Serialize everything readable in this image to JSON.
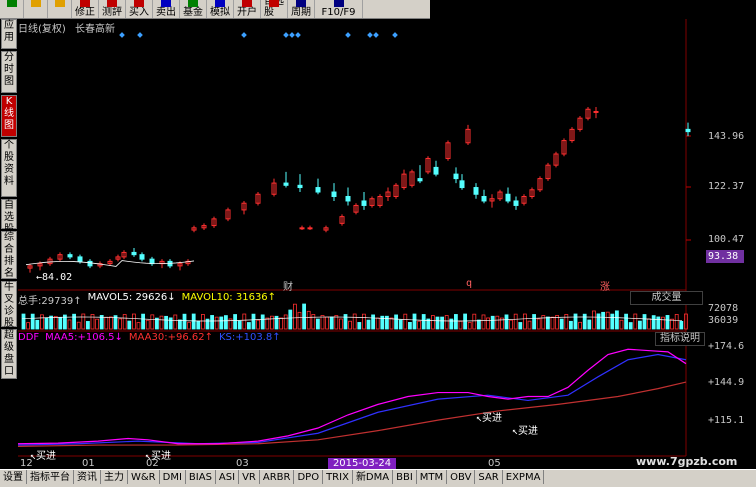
{
  "toolbar": {
    "buttons": [
      {
        "label": "",
        "icon": "grid-icon"
      },
      {
        "label": "",
        "icon": "arrow-up-icon"
      },
      {
        "label": "",
        "icon": "arrow-down-icon"
      },
      {
        "label": "修正",
        "icon": "edit-icon"
      },
      {
        "label": "测評",
        "icon": "rate-icon"
      },
      {
        "label": "买入",
        "icon": "buy-icon"
      },
      {
        "label": "卖出",
        "icon": "sell-icon"
      },
      {
        "label": "基金",
        "icon": "fund-icon"
      },
      {
        "label": "模拟",
        "icon": "sim-icon"
      },
      {
        "label": "开户",
        "icon": "account-icon"
      },
      {
        "label": "自选股",
        "icon": "star-icon"
      },
      {
        "label": "周期",
        "icon": "period-icon"
      },
      {
        "label": "F10/F9",
        "icon": "f10-icon"
      }
    ]
  },
  "sidebar": {
    "tabs": [
      {
        "label": "应用"
      },
      {
        "label": "分时图"
      },
      {
        "label": "K线图",
        "active": true
      },
      {
        "label": "个股资料"
      },
      {
        "label": "自选股"
      },
      {
        "label": "综合排名"
      },
      {
        "label": "牛叉诊股"
      },
      {
        "label": "超级盘口"
      }
    ]
  },
  "header": {
    "title": "日线(复权)",
    "stock_name": "长春高新"
  },
  "price_axis": {
    "labels": [
      "143.96",
      "122.37",
      "100.47"
    ],
    "current_price": "93.38",
    "low_marker": "84.02"
  },
  "event_marks": [
    "财",
    "q",
    "涨"
  ],
  "volume": {
    "total_label": "总手:",
    "total_value": "29739",
    "mavol5_label": "MAVOL5:",
    "mavol5_value": "29626",
    "mavol10_label": "MAVOL10:",
    "mavol10_value": "31636",
    "selector": "成交量",
    "axis": [
      "72078",
      "36039"
    ]
  },
  "indicator": {
    "name": "DDF",
    "maa5_label": "MAA5:",
    "maa5_value": "+106.5",
    "maa30_label": "MAA30:",
    "maa30_value": "+96.62",
    "ks_label": "KS:",
    "ks_value": "+103.8",
    "help": "指标说明",
    "axis": [
      "+174.6",
      "+144.9",
      "+115.1"
    ],
    "buy_signal": "买进"
  },
  "time_axis": {
    "months": [
      "12",
      "01",
      "02",
      "03",
      "05"
    ],
    "selected_date": "2015-03-24"
  },
  "bottom_tabs": [
    "设置",
    "指标平台",
    "资讯",
    "主力",
    "W&R",
    "DMI",
    "BIAS",
    "ASI",
    "VR",
    "ARBR",
    "DPO",
    "TRIX",
    "新DMA",
    "BBI",
    "MTM",
    "OBV",
    "SAR",
    "EXPMA"
  ],
  "watermark": "www.7gpzb.com",
  "colors": {
    "up": "#ff3030",
    "down": "#54ffff",
    "ma_magenta": "#ff00ff",
    "ma_blue": "#3030ff",
    "ma_red": "#c03030",
    "accent": "#7030a0"
  },
  "chart_data": {
    "type": "candlestick",
    "price_ylim": [
      84.02,
      160
    ],
    "ohlc_sample": [
      [
        88,
        90,
        86,
        89
      ],
      [
        89,
        91,
        87,
        90
      ],
      [
        90,
        93,
        89,
        92
      ],
      [
        92,
        95,
        91,
        94
      ],
      [
        94,
        95,
        92,
        93
      ],
      [
        93,
        94,
        90,
        91
      ],
      [
        91,
        92,
        88,
        89
      ],
      [
        89,
        91,
        88,
        90
      ],
      [
        90,
        92,
        89,
        91
      ],
      [
        105,
        107,
        104,
        106
      ],
      [
        106,
        108,
        105,
        107
      ],
      [
        107,
        111,
        106,
        110
      ],
      [
        110,
        115,
        109,
        114
      ],
      [
        114,
        118,
        112,
        117
      ],
      [
        117,
        122,
        116,
        121
      ],
      [
        121,
        128,
        120,
        126
      ],
      [
        126,
        131,
        124,
        125
      ],
      [
        125,
        130,
        122,
        124
      ],
      [
        124,
        128,
        121,
        122
      ],
      [
        122,
        126,
        118,
        120
      ],
      [
        120,
        124,
        116,
        118
      ],
      [
        118,
        122,
        114,
        116
      ],
      [
        116,
        121,
        115,
        120
      ],
      [
        120,
        126,
        119,
        125
      ],
      [
        125,
        132,
        124,
        131
      ],
      [
        131,
        138,
        130,
        137
      ],
      [
        137,
        145,
        136,
        144
      ],
      [
        144,
        152,
        143,
        150
      ]
    ]
  }
}
